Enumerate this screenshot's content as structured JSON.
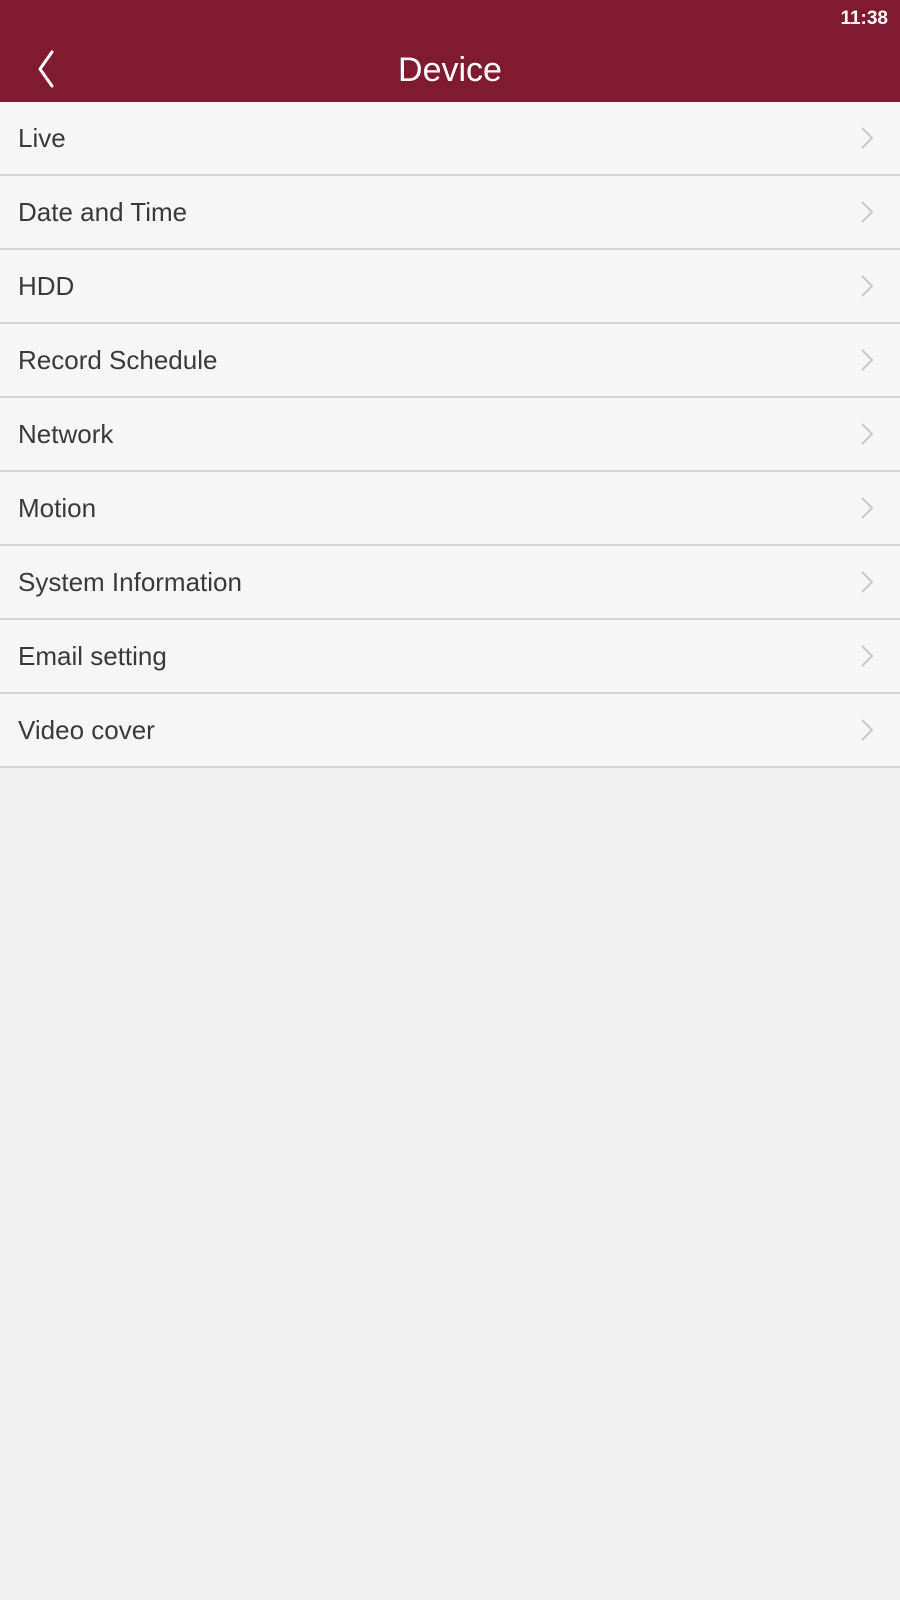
{
  "status_bar": {
    "time": "11:38"
  },
  "header": {
    "title": "Device",
    "back_icon": "chevron-left-icon",
    "background_color": "#7f1a30"
  },
  "menu": {
    "items": [
      {
        "label": "Live",
        "icon": "chevron-right-icon"
      },
      {
        "label": "Date and Time",
        "icon": "chevron-right-icon"
      },
      {
        "label": "HDD",
        "icon": "chevron-right-icon"
      },
      {
        "label": "Record Schedule",
        "icon": "chevron-right-icon"
      },
      {
        "label": "Network",
        "icon": "chevron-right-icon"
      },
      {
        "label": "Motion",
        "icon": "chevron-right-icon"
      },
      {
        "label": "System Information",
        "icon": "chevron-right-icon"
      },
      {
        "label": "Email setting",
        "icon": "chevron-right-icon"
      },
      {
        "label": "Video cover",
        "icon": "chevron-right-icon"
      }
    ]
  }
}
